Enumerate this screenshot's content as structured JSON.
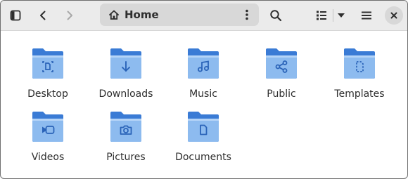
{
  "window": {
    "title": "Home"
  },
  "headerbar": {
    "sidebar_toggle_icon": "sidebar-icon",
    "back_icon": "chevron-left-icon",
    "forward_icon": "chevron-right-icon",
    "path": {
      "icon": "home-icon",
      "label": "Home",
      "menu_icon": "vertical-dots-icon"
    },
    "search_icon": "search-icon",
    "view_icon": "list-view-icon",
    "view_dropdown_icon": "triangle-down-icon",
    "menu_icon": "hamburger-icon",
    "close_icon": "close-icon"
  },
  "folders": [
    {
      "label": "Desktop",
      "emblem": "desktop-icon"
    },
    {
      "label": "Downloads",
      "emblem": "download-arrow-icon"
    },
    {
      "label": "Music",
      "emblem": "music-note-icon"
    },
    {
      "label": "Public",
      "emblem": "share-icon"
    },
    {
      "label": "Templates",
      "emblem": "template-icon"
    },
    {
      "label": "Videos",
      "emblem": "video-camera-icon"
    },
    {
      "label": "Pictures",
      "emblem": "camera-icon"
    },
    {
      "label": "Documents",
      "emblem": "document-icon"
    }
  ],
  "colors": {
    "folder_back": "#3a7bd5",
    "folder_front_top": "#a6cdf5",
    "folder_front_bottom": "#6ea6e8",
    "emblem": "#2a63b8"
  }
}
